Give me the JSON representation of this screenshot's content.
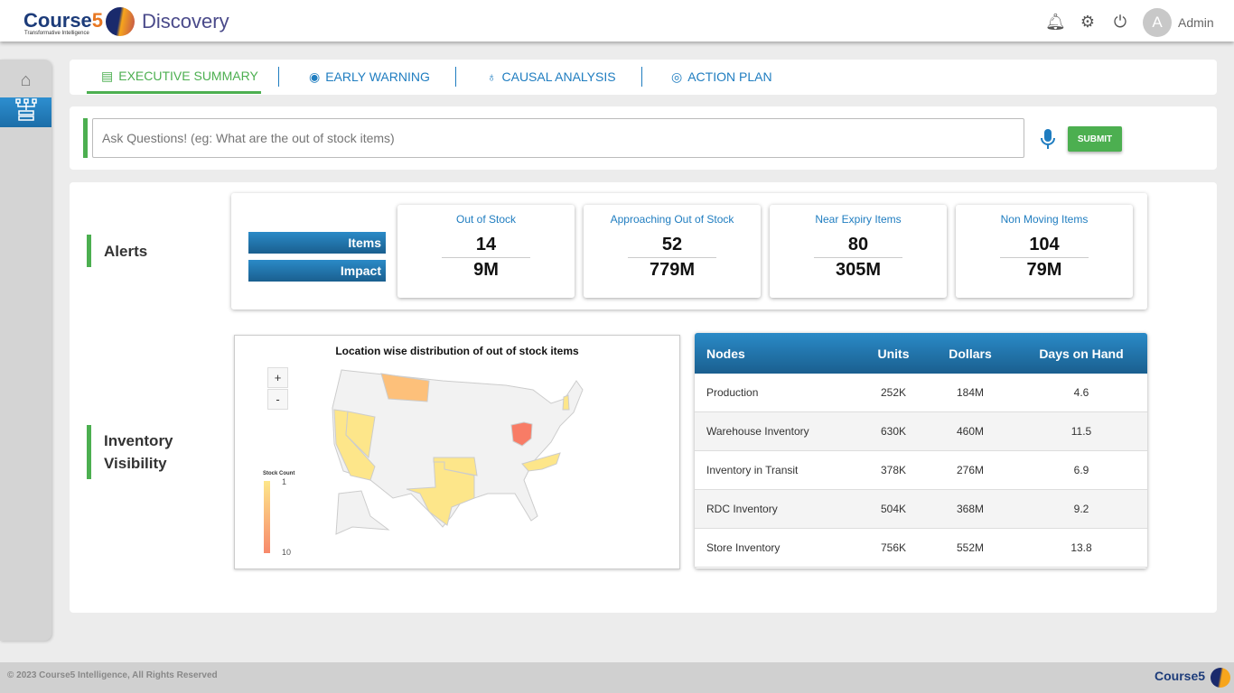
{
  "header": {
    "brand": "Course",
    "brand_num": "5",
    "tagline": "Transformative Intelligence",
    "app": "Discovery",
    "user_initial": "A",
    "user": "Admin"
  },
  "tabs": [
    {
      "label": "EXECUTIVE SUMMARY"
    },
    {
      "label": "EARLY WARNING"
    },
    {
      "label": "CAUSAL ANALYSIS"
    },
    {
      "label": "ACTION PLAN"
    }
  ],
  "search": {
    "placeholder": "Ask Questions! (eg: What are the out of stock items)",
    "submit": "SUBMIT"
  },
  "alerts": {
    "title": "Alerts",
    "row_labels": [
      "Items",
      "Impact"
    ],
    "cards": [
      {
        "title": "Out of Stock",
        "items": "14",
        "impact": "9M"
      },
      {
        "title": "Approaching Out of Stock",
        "items": "52",
        "impact": "779M"
      },
      {
        "title": "Near Expiry Items",
        "items": "80",
        "impact": "305M"
      },
      {
        "title": "Non Moving Items",
        "items": "104",
        "impact": "79M"
      }
    ]
  },
  "inventory": {
    "title_line1": "Inventory",
    "title_line2": "Visibility"
  },
  "map": {
    "title": "Location wise distribution of out of stock items",
    "zoom_in": "+",
    "zoom_out": "-",
    "legend_title": "Stock Count",
    "legend_min": "1",
    "legend_max": "10",
    "states": [
      {
        "name": "Ohio",
        "count": 10
      },
      {
        "name": "Montana",
        "count": 4
      },
      {
        "name": "California",
        "count": 1
      },
      {
        "name": "Nevada",
        "count": 1
      },
      {
        "name": "Texas",
        "count": 1
      },
      {
        "name": "Oklahoma",
        "count": 1
      },
      {
        "name": "North Carolina",
        "count": 1
      },
      {
        "name": "New Hampshire",
        "count": 1
      }
    ]
  },
  "table": {
    "headers": [
      "Nodes",
      "Units",
      "Dollars",
      "Days on Hand"
    ],
    "rows": [
      [
        "Production",
        "252K",
        "184M",
        "4.6"
      ],
      [
        "Warehouse Inventory",
        "630K",
        "460M",
        "11.5"
      ],
      [
        "Inventory in Transit",
        "378K",
        "276M",
        "6.9"
      ],
      [
        "RDC Inventory",
        "504K",
        "368M",
        "9.2"
      ],
      [
        "Store Inventory",
        "756K",
        "552M",
        "13.8"
      ]
    ]
  },
  "footer": {
    "copyright": "© 2023 Course5 Intelligence, All Rights Reserved",
    "logo": "Course5"
  }
}
